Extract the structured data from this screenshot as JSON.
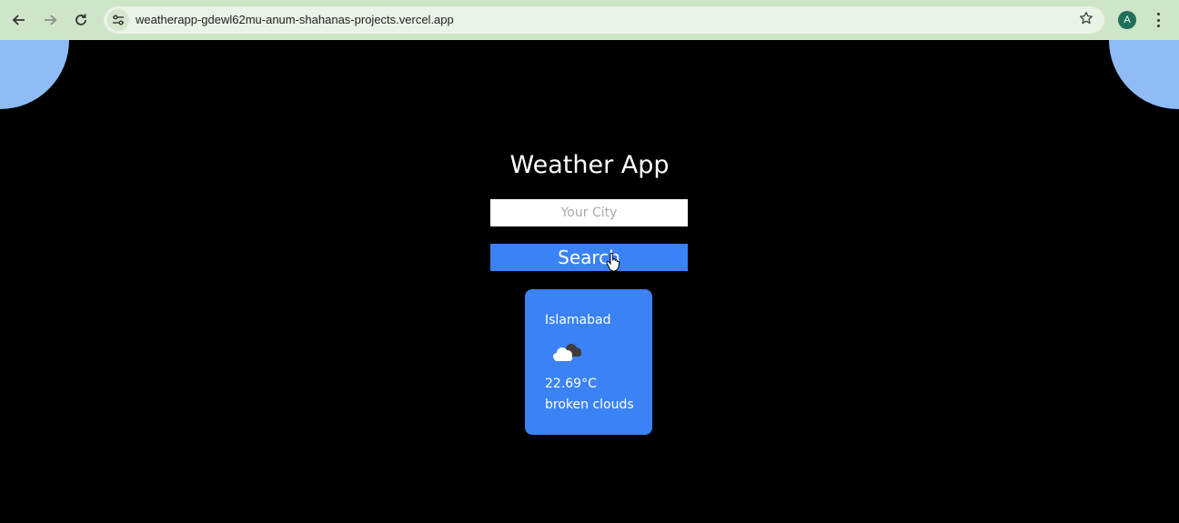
{
  "browser": {
    "url": "weatherapp-gdewl62mu-anum-shahanas-projects.vercel.app",
    "profile_initial": "A",
    "chrome_color": "#cfe5c9"
  },
  "icons": {
    "back": "arrow-left-icon",
    "forward": "arrow-right-icon",
    "reload": "reload-icon",
    "site_info": "tune-icon",
    "bookmark": "star-icon",
    "menu": "more-vert-icon",
    "weather": "broken-clouds-icon",
    "cursor": "hand-pointer-icon"
  },
  "app": {
    "title": "Weather App",
    "city_input": {
      "placeholder": "Your City",
      "value": ""
    },
    "search_label": "Search",
    "accent_color": "#3b82f6",
    "decor_color": "#8fbcf6"
  },
  "weather_card": {
    "city": "Islamabad",
    "temperature": "22.69°C",
    "description": "broken clouds"
  }
}
